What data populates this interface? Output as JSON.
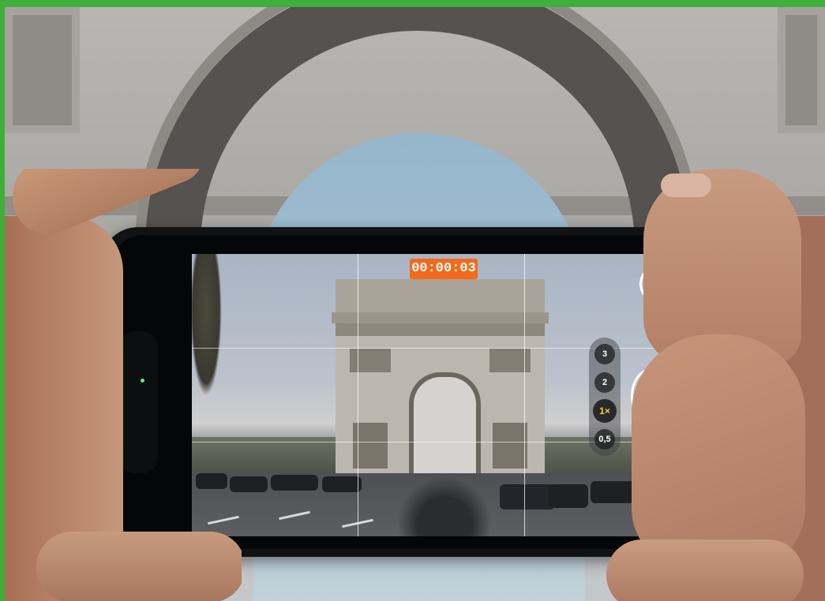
{
  "viewfinder": {
    "recording_timer": "00:00:03",
    "zoom_levels": [
      "3",
      "2",
      "1×",
      "0,5"
    ],
    "selected_zoom": "1×",
    "accent_color": "#f26a1b"
  },
  "controls": {
    "shutter_icon": "photo-shutter-icon",
    "record_icon": "stop-recording-icon"
  }
}
